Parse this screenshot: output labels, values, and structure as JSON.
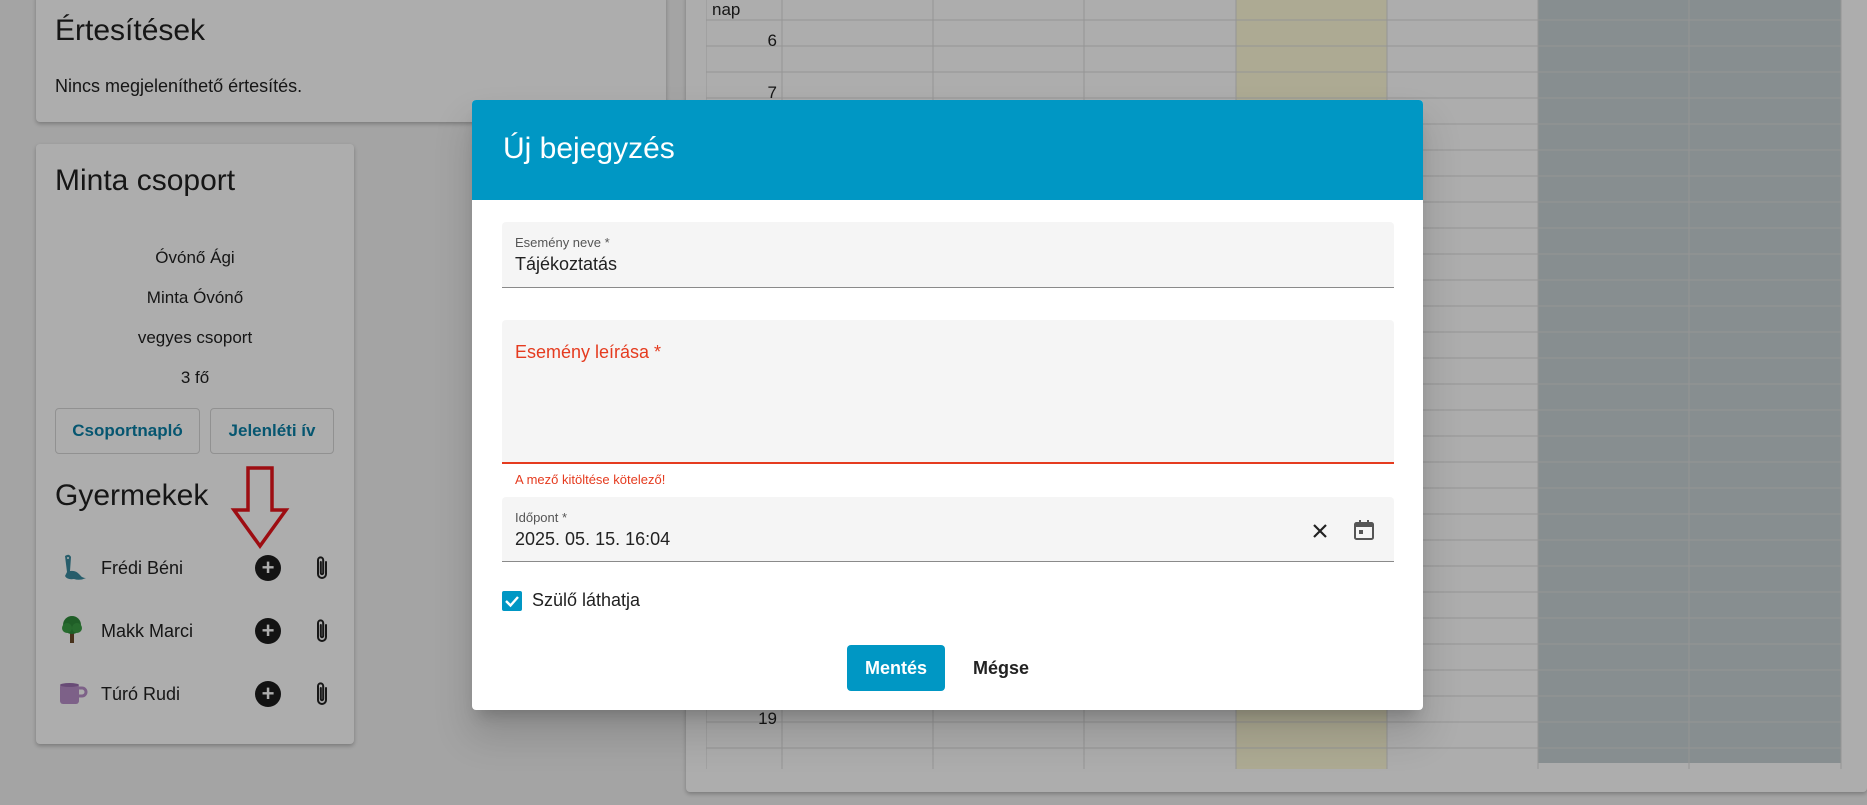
{
  "notifications": {
    "title": "Értesítések",
    "empty_text": "Nincs megjeleníthető értesítés."
  },
  "group": {
    "title": "Minta csoport",
    "info": [
      "Óvónő Ági",
      "Minta Óvónő",
      "vegyes csoport",
      "3 fő"
    ],
    "buttons": {
      "journal": "Csoportnapló",
      "attendance": "Jelenléti ív"
    },
    "children_title": "Gyermekek",
    "children": [
      {
        "name": "Frédi Béni",
        "avatar": "dinosaur-icon"
      },
      {
        "name": "Makk Marci",
        "avatar": "tree-icon"
      },
      {
        "name": "Túró Rudi",
        "avatar": "mug-icon"
      }
    ]
  },
  "calendar": {
    "header_label": "nap",
    "row_labels": [
      "6",
      "7",
      "19"
    ]
  },
  "dialog": {
    "title": "Új bejegyzés",
    "name_field": {
      "label": "Esemény neve *",
      "value": "Tájékoztatás"
    },
    "desc_field": {
      "label": "Esemény leírása *",
      "error": "A mező kitöltése kötelező!"
    },
    "date_field": {
      "label": "Időpont *",
      "value": "2025. 05. 15. 16:04"
    },
    "parent_visible": {
      "label": "Szülő láthatja",
      "checked": true
    },
    "save_label": "Mentés",
    "cancel_label": "Mégse"
  },
  "colors": {
    "primary": "#0097c4",
    "error": "#e53b1f",
    "highlight_column": "#fffbd9",
    "weekend_column": "#c8d1d4"
  }
}
